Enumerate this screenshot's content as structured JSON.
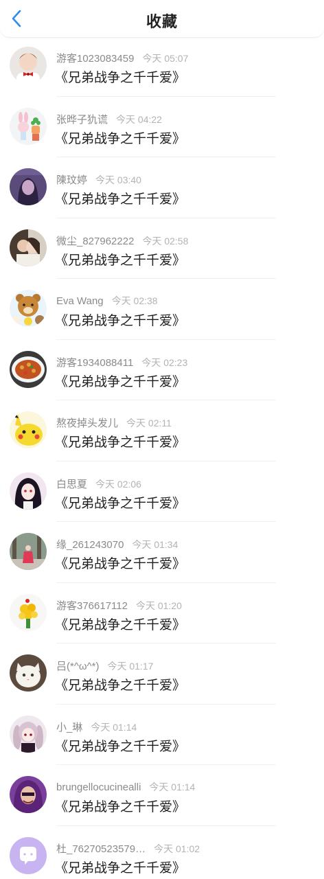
{
  "header": {
    "title": "收藏",
    "back_icon": "chevron-left-icon",
    "accent_color": "#2d8cf0"
  },
  "items": [
    {
      "user": "游客1023083459",
      "time": "今天 05:07",
      "work": "《兄弟战争之千千爱》",
      "avatar_icon": "child-with-bowtie-avatar"
    },
    {
      "user": "张晔子犰谎",
      "time": "今天 04:22",
      "work": "《兄弟战争之千千爱》",
      "avatar_icon": "bunny-cactus-avatar"
    },
    {
      "user": "陳玟婷",
      "time": "今天 03:40",
      "work": "《兄弟战争之千千爱》",
      "avatar_icon": "purple-portrait-avatar"
    },
    {
      "user": "微尘_827962222",
      "time": "今天 02:58",
      "work": "《兄弟战争之千千爱》",
      "avatar_icon": "couple-photo-avatar"
    },
    {
      "user": "Eva Wang",
      "time": "今天 02:38",
      "work": "《兄弟战争之千千爱》",
      "avatar_icon": "rilakkuma-bear-avatar"
    },
    {
      "user": "游客1934088411",
      "time": "今天 02:23",
      "work": "《兄弟战争之千千爱》",
      "avatar_icon": "food-dish-avatar"
    },
    {
      "user": "熬夜掉头发儿",
      "time": "今天 02:11",
      "work": "《兄弟战争之千千爱》",
      "avatar_icon": "pikachu-avatar"
    },
    {
      "user": "白思夏",
      "time": "今天 02:06",
      "work": "《兄弟战争之千千爱》",
      "avatar_icon": "anime-girl-dark-hair-avatar"
    },
    {
      "user": "缘_261243070",
      "time": "今天 01:34",
      "work": "《兄弟战争之千千爱》",
      "avatar_icon": "forest-girl-avatar"
    },
    {
      "user": "游客376617112",
      "time": "今天 01:20",
      "work": "《兄弟战争之千千爱》",
      "avatar_icon": "flower-bouquet-avatar"
    },
    {
      "user": "吕(*^ω^*)",
      "time": "今天 01:17",
      "work": "《兄弟战争之千千爱》",
      "avatar_icon": "white-cat-avatar"
    },
    {
      "user": "小_琳",
      "time": "今天 01:14",
      "work": "《兄弟战争之千千爱》",
      "avatar_icon": "anime-girl-pigtails-avatar"
    },
    {
      "user": "brungellocucinealli",
      "time": "今天 01:14",
      "work": "《兄弟战争之千千爱》",
      "avatar_icon": "purple-character-avatar"
    },
    {
      "user": "杜_76270523579…",
      "time": "今天 01:02",
      "work": "《兄弟战争之千千爱》",
      "avatar_icon": "default-chat-avatar"
    }
  ]
}
